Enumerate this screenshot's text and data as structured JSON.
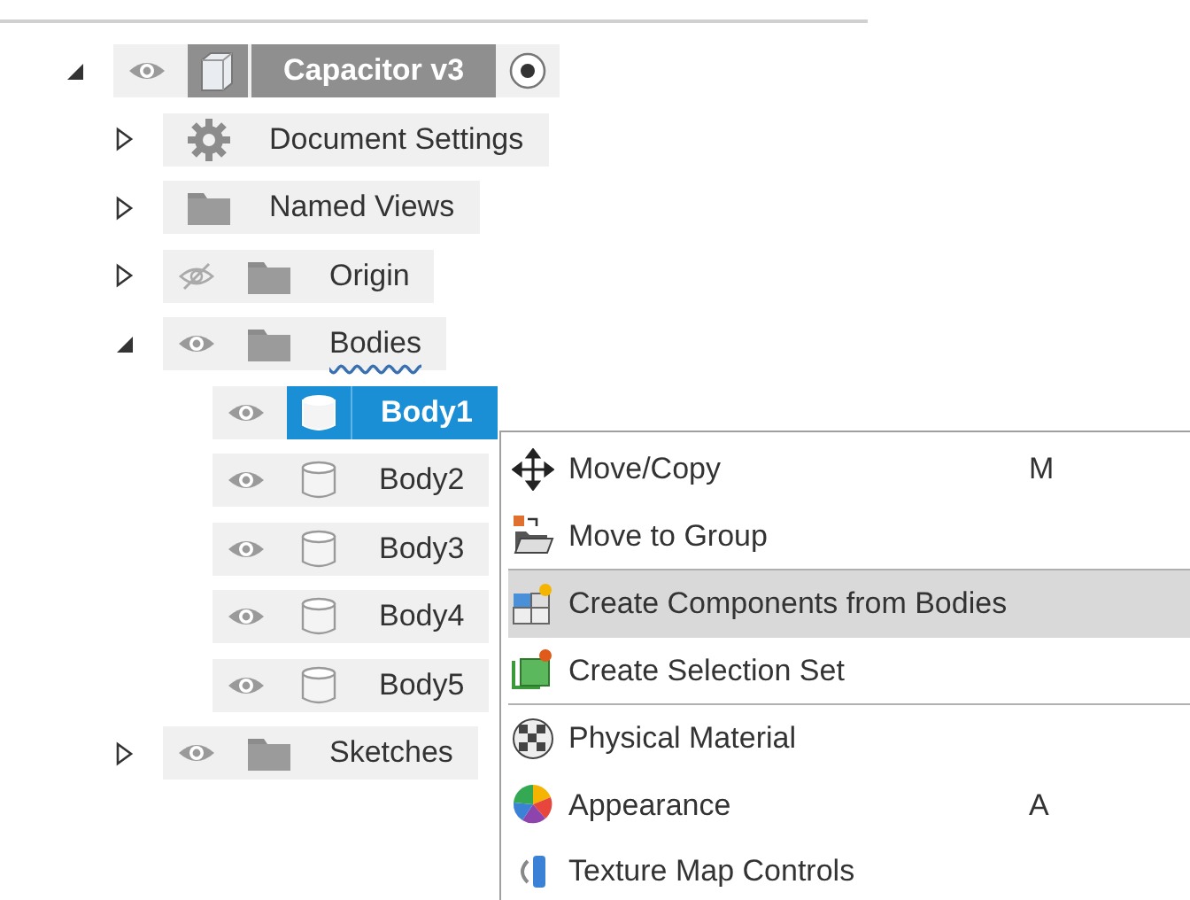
{
  "tree": [
    {
      "label": "Capacitor v3",
      "kind": "component",
      "expanded": true,
      "visible": true,
      "active": true,
      "selected": false,
      "children": [
        {
          "label": "Document Settings",
          "kind": "settings",
          "expanded": false,
          "selected": false
        },
        {
          "label": "Named Views",
          "kind": "folder",
          "expanded": false,
          "selected": false
        },
        {
          "label": "Origin",
          "kind": "folder",
          "expanded": false,
          "visible": false,
          "selected": false
        },
        {
          "label": "Bodies",
          "kind": "folder",
          "expanded": true,
          "visible": true,
          "wavy_underline": true,
          "selected": false,
          "children": [
            {
              "label": "Body1",
              "kind": "body",
              "visible": true,
              "selected": true
            },
            {
              "label": "Body2",
              "kind": "body",
              "visible": true,
              "selected": false
            },
            {
              "label": "Body3",
              "kind": "body",
              "visible": true,
              "selected": false
            },
            {
              "label": "Body4",
              "kind": "body",
              "visible": true,
              "selected": false
            },
            {
              "label": "Body5",
              "kind": "body",
              "visible": true,
              "selected": false
            }
          ]
        },
        {
          "label": "Sketches",
          "kind": "folder",
          "expanded": false,
          "visible": true,
          "selected": false
        }
      ]
    }
  ],
  "context_menu": {
    "groups": [
      [
        {
          "label": "Move/Copy",
          "kind": "move",
          "shortcut": "M",
          "selected": false
        },
        {
          "label": "Move to Group",
          "kind": "group",
          "selected": false
        }
      ],
      [
        {
          "label": "Create Components from Bodies",
          "kind": "components",
          "selected": true
        },
        {
          "label": "Create Selection Set",
          "kind": "selection-set",
          "selected": false
        }
      ],
      [
        {
          "label": "Physical Material",
          "kind": "material",
          "selected": false
        },
        {
          "label": "Appearance",
          "kind": "appearance",
          "shortcut": "A",
          "selected": false
        },
        {
          "label": "Texture Map Controls",
          "kind": "texture",
          "selected": false
        }
      ]
    ]
  }
}
